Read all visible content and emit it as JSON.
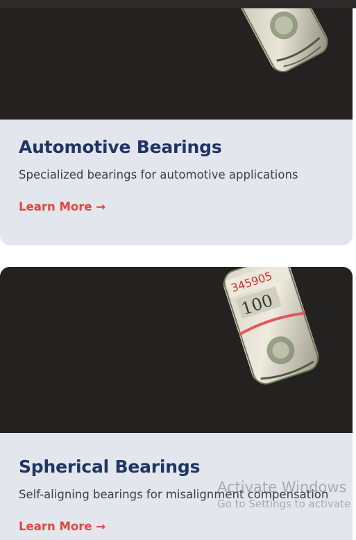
{
  "cards": [
    {
      "title": "Automotive Bearings",
      "description": "Specialized bearings for automotive applications",
      "link_label": "Learn More →"
    },
    {
      "title": "Spherical Bearings",
      "description": "Self-aligning bearings for misalignment compensation",
      "link_label": "Learn More →",
      "image_text": "345905"
    }
  ],
  "watermark": {
    "title": "Activate Windows",
    "subtitle": "Go to Settings to activate"
  },
  "colors": {
    "title": "#1f3563",
    "link": "#e0463c",
    "card_bg": "#e3e6ec",
    "image_bg": "#232220"
  }
}
